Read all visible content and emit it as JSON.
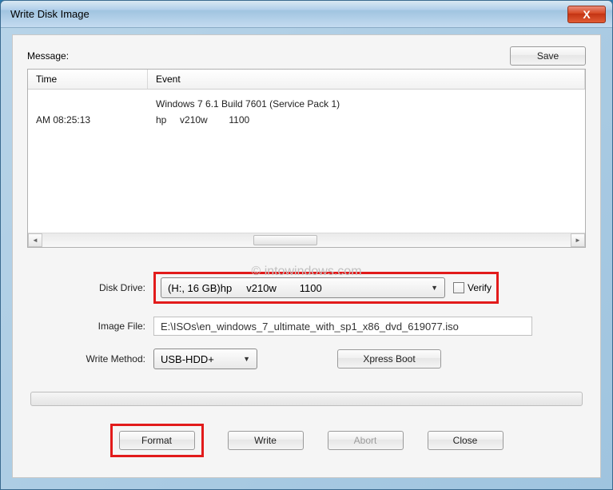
{
  "window": {
    "title": "Write Disk Image",
    "close_icon": "X"
  },
  "message": {
    "label": "Message:",
    "save_btn": "Save",
    "headers": {
      "time": "Time",
      "event": "Event"
    },
    "rows": [
      {
        "time": "",
        "event": "Windows 7 6.1 Build 7601 (Service Pack 1)"
      },
      {
        "time": "AM 08:25:13",
        "event": "hp     v210w        1100"
      }
    ]
  },
  "form": {
    "disk_drive": {
      "label": "Disk Drive:",
      "value": "(H:, 16 GB)hp     v210w        1100"
    },
    "verify_label": "Verify",
    "image_file": {
      "label": "Image File:",
      "value": "E:\\ISOs\\en_windows_7_ultimate_with_sp1_x86_dvd_619077.iso"
    },
    "write_method": {
      "label": "Write Method:",
      "value": "USB-HDD+"
    },
    "xpress_boot_btn": "Xpress Boot"
  },
  "buttons": {
    "format": "Format",
    "write": "Write",
    "abort": "Abort",
    "close": "Close"
  },
  "watermark": "© intowindows.com"
}
